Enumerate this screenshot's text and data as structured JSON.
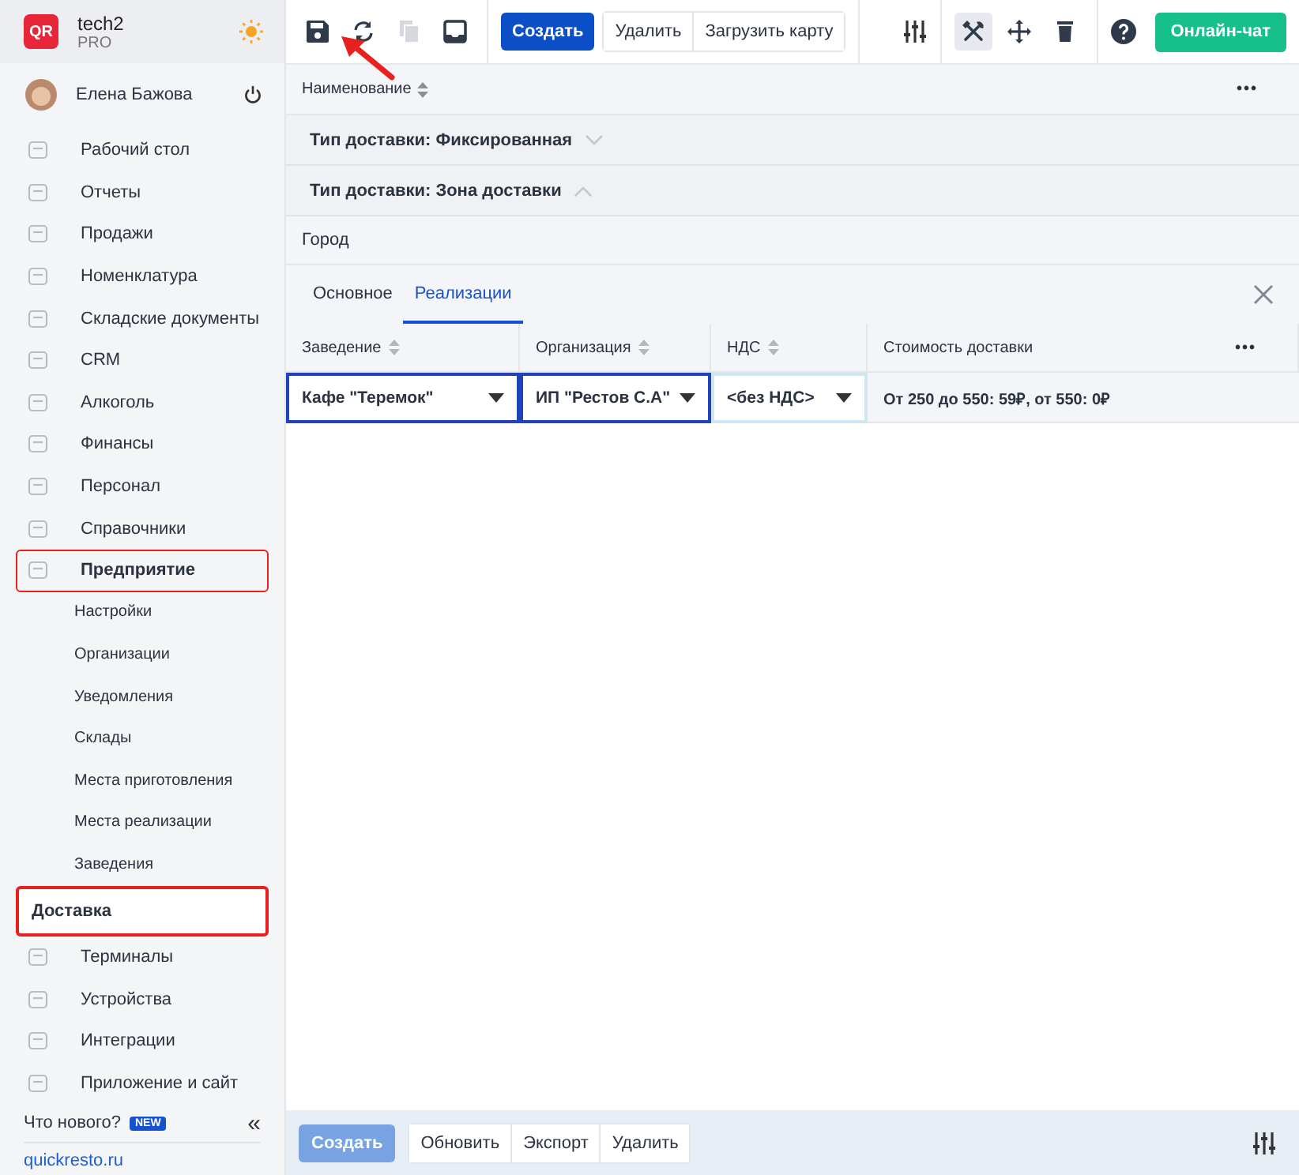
{
  "brand": {
    "logo": "QR",
    "name": "tech2",
    "plan": "PRO"
  },
  "user": {
    "name": "Елена Бажова"
  },
  "nav": [
    {
      "label": "Рабочий стол",
      "selected": false,
      "highlighted": false
    },
    {
      "label": "Отчеты",
      "selected": false,
      "highlighted": false
    },
    {
      "label": "Продажи",
      "selected": false,
      "highlighted": false
    },
    {
      "label": "Номенклатура",
      "selected": false,
      "highlighted": false
    },
    {
      "label": "Складские документы",
      "selected": false,
      "highlighted": false
    },
    {
      "label": "CRM",
      "selected": false,
      "highlighted": false
    },
    {
      "label": "Алкоголь",
      "selected": false,
      "highlighted": false
    },
    {
      "label": "Финансы",
      "selected": false,
      "highlighted": false
    },
    {
      "label": "Персонал",
      "selected": false,
      "highlighted": false
    },
    {
      "label": "Справочники",
      "selected": false,
      "highlighted": false
    },
    {
      "label": "Предприятие",
      "selected": false,
      "highlighted": true,
      "children": [
        {
          "label": "Настройки",
          "selected": false,
          "highlighted": false
        },
        {
          "label": "Организации",
          "selected": false,
          "highlighted": false
        },
        {
          "label": "Уведомления",
          "selected": false,
          "highlighted": false
        },
        {
          "label": "Склады",
          "selected": false,
          "highlighted": false
        },
        {
          "label": "Места приготовления",
          "selected": false,
          "highlighted": false
        },
        {
          "label": "Места реализации",
          "selected": false,
          "highlighted": false
        },
        {
          "label": "Заведения",
          "selected": false,
          "highlighted": false
        },
        {
          "label": "Доставка",
          "selected": true,
          "highlighted": true
        }
      ]
    },
    {
      "label": "Терминалы",
      "selected": false,
      "highlighted": false
    },
    {
      "label": "Устройства",
      "selected": false,
      "highlighted": false
    },
    {
      "label": "Интеграции",
      "selected": false,
      "highlighted": false
    },
    {
      "label": "Приложение и сайт",
      "selected": false,
      "highlighted": false
    }
  ],
  "footer": {
    "whats_new": "Что нового?",
    "badge": "NEW",
    "collapse": "«",
    "link": "quickresto.ru"
  },
  "toolbar": {
    "file_tools": [
      {
        "kind": "save",
        "disabled": false
      },
      {
        "kind": "refresh",
        "disabled": false
      },
      {
        "kind": "copy",
        "disabled": true
      },
      {
        "kind": "inbox",
        "disabled": false
      }
    ],
    "create": "Создать",
    "actions": [
      "Удалить",
      "Загрузить карту"
    ],
    "edit_tools": [
      {
        "kind": "tools",
        "selected": true
      },
      {
        "kind": "move",
        "selected": false
      },
      {
        "kind": "trash",
        "selected": false
      }
    ],
    "chat": "Онлайн-чат"
  },
  "list": {
    "column": "Наименование",
    "more": "•••",
    "groups": [
      {
        "label": "Тип доставки: Фиксированная",
        "expanded": false
      },
      {
        "label": "Тип доставки: Зона доставки",
        "expanded": true
      }
    ],
    "rows": [
      "Город"
    ]
  },
  "detail": {
    "tabs": [
      {
        "label": "Основное",
        "selected": false
      },
      {
        "label": "Реализации",
        "selected": true
      }
    ],
    "columns": [
      "Заведение",
      "Организация",
      "НДС",
      "Стоимость доставки"
    ],
    "more": "•••",
    "rows": [
      {
        "cells": [
          {
            "kind": "select",
            "value": "Кафе \"Теремок\"",
            "active": true
          },
          {
            "kind": "select",
            "value": "ИП \"Рестов С.А\"",
            "active": true
          },
          {
            "kind": "select",
            "value": "<без НДС>",
            "active": false
          },
          {
            "kind": "text",
            "value": "От 250 до 550: 59₽, от 550: 0₽"
          }
        ]
      }
    ]
  },
  "bottom": {
    "buttons": [
      {
        "label": "Создать",
        "kind": "primary",
        "disabled": true
      },
      {
        "label": "Обновить",
        "kind": "plain",
        "disabled": false
      },
      {
        "label": "Экспорт",
        "kind": "plain",
        "disabled": false
      },
      {
        "label": "Удалить",
        "kind": "plain",
        "disabled": false
      }
    ]
  }
}
